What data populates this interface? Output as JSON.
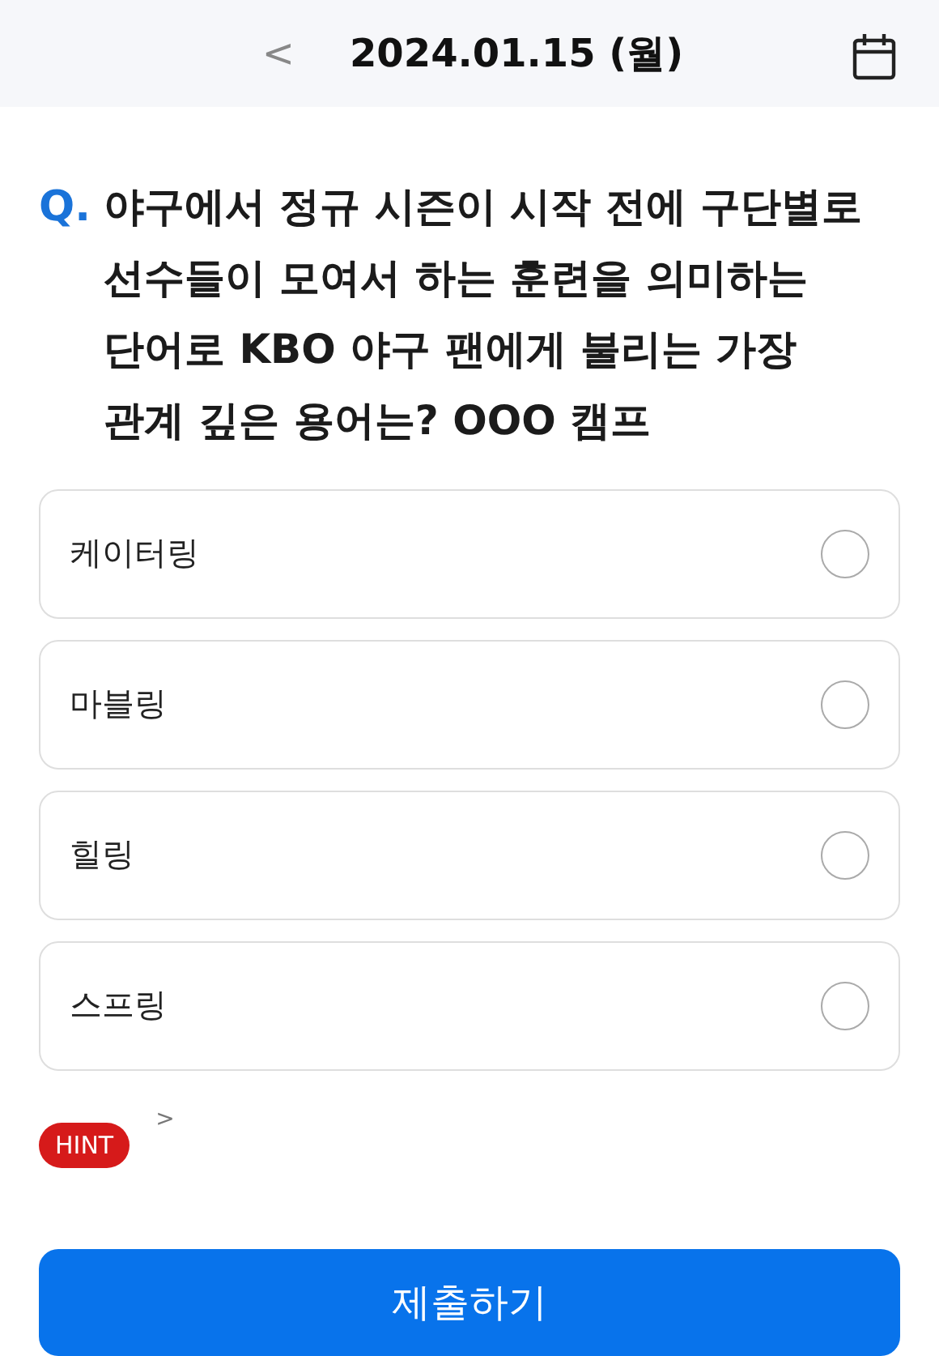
{
  "header": {
    "back": "<",
    "date": "2024.01.15 (월)"
  },
  "question": {
    "prefix": "Q.",
    "text": "야구에서 정규 시즌이 시작 전에 구단별로 선수들이 모여서 하는 훈련을 의미하는 단어로 KBO 야구 팬에게 불리는 가장 관계 깊은 용어는? OOO 캠프"
  },
  "options": [
    {
      "label": "케이터링",
      "selected": false
    },
    {
      "label": "마블링",
      "selected": false
    },
    {
      "label": "힐링",
      "selected": false
    },
    {
      "label": "스프링",
      "selected": false
    }
  ],
  "hint": {
    "label": "HINT",
    "arrow": ">"
  },
  "submit": {
    "label": "제출하기"
  }
}
